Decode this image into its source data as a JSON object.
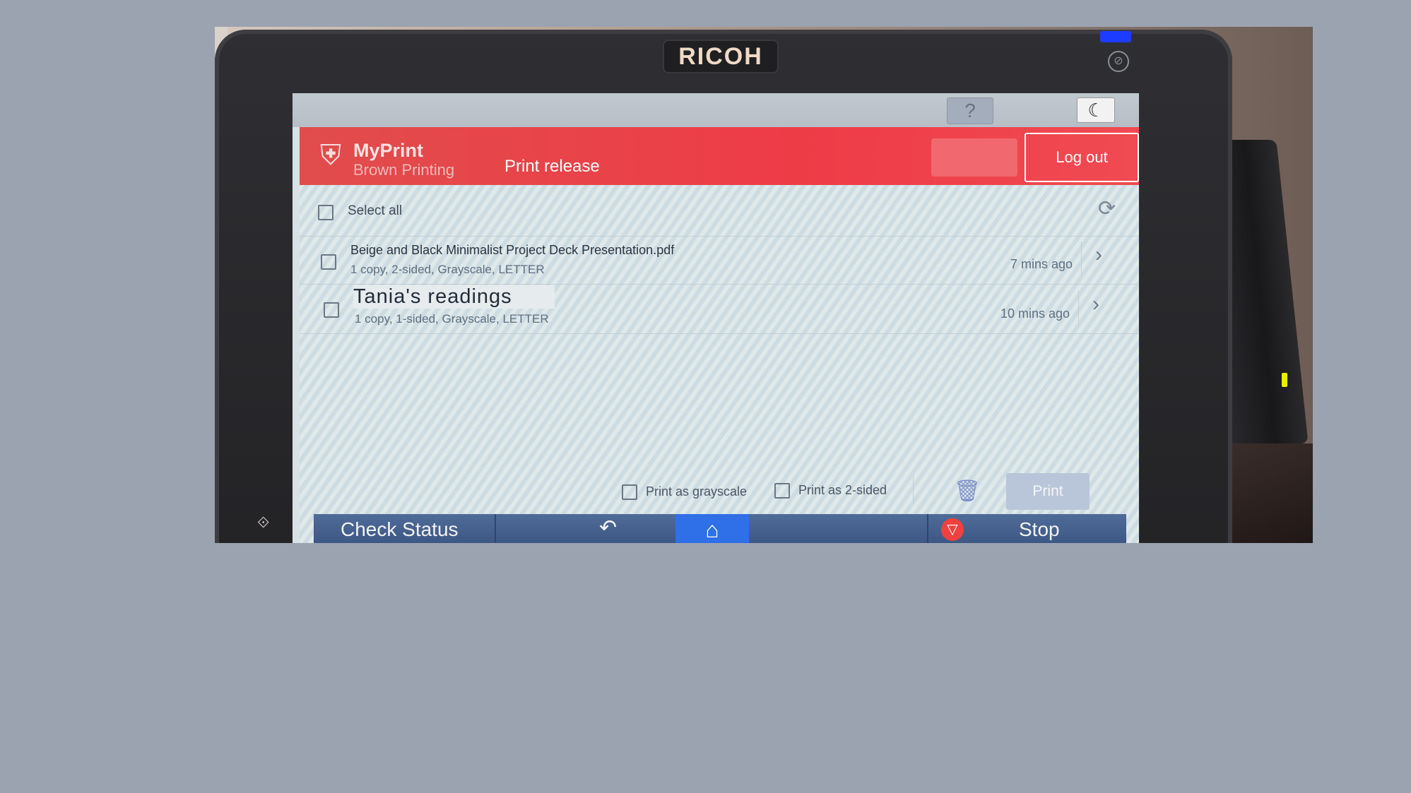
{
  "device": {
    "brand": "RICOH",
    "power_icon": "eco-power-icon",
    "side_icon": "login-arrow-icon"
  },
  "system_bar": {
    "help_label": "?",
    "sleep_icon": "moon-icon"
  },
  "header": {
    "logo_icon": "university-crest-icon",
    "app_name": "MyPrint",
    "app_subtitle": "Brown Printing",
    "page_title": "Print release",
    "logout_label": "Log out"
  },
  "list": {
    "select_all_label": "Select all",
    "refresh_icon": "refresh-icon",
    "jobs": [
      {
        "title": "Beige and Black Minimalist Project Deck Presentation.pdf",
        "meta": "1 copy, 2-sided, Grayscale, LETTER",
        "time": "7 mins ago"
      },
      {
        "title": "Tania's readings",
        "meta": "1 copy, 1-sided, Grayscale, LETTER",
        "time": "10 mins ago"
      }
    ]
  },
  "options": {
    "grayscale_label": "Print as grayscale",
    "two_sided_label": "Print as 2-sided",
    "delete_icon": "trash-icon",
    "print_label": "Print"
  },
  "taskbar": {
    "check_status_label": "Check Status",
    "back_icon": "back-arrow-icon",
    "home_icon": "home-icon",
    "stop_icon": "stop-icon",
    "stop_label": "Stop"
  },
  "colors": {
    "header_red": "#ee3c47",
    "taskbar_blue": "#3c5683",
    "home_highlight": "#2f6fe8",
    "page_background": "#9ca3b0"
  }
}
